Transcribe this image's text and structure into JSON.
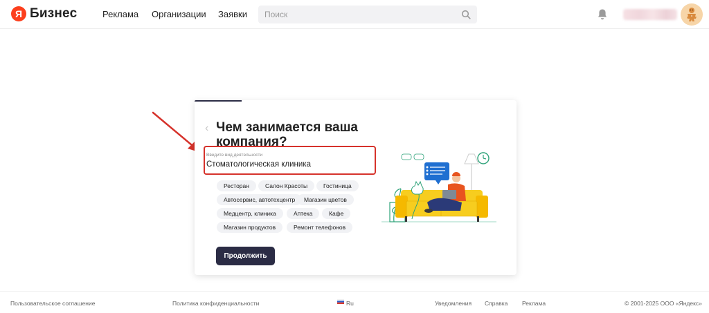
{
  "header": {
    "logo_letter": "Я",
    "logo_text": "Бизнес",
    "nav": [
      "Реклама",
      "Организации",
      "Заявки"
    ],
    "search_placeholder": "Поиск"
  },
  "card": {
    "back": "‹",
    "title": "Чем занимается ваша компания?",
    "field_label": "Введите вид деятельности",
    "field_value": "Стоматологическая клиника",
    "chips": [
      "Ресторан",
      "Салон Красоты",
      "Гостиница",
      "Автосервис, автотехцентр",
      "Магазин цветов",
      "Медцентр, клиника",
      "Аптека",
      "Кафе",
      "Магазин продуктов",
      "Ремонт телефонов"
    ],
    "continue_label": "Продолжить"
  },
  "footer": {
    "terms": "Пользовательское соглашение",
    "privacy": "Политика конфиденциальности",
    "lang": "Ru",
    "notifications": "Уведомления",
    "help": "Справка",
    "ads": "Реклама",
    "copyright": "© 2001-2025 ООО «Яндекс»"
  },
  "colors": {
    "accent_dark": "#2b2c45",
    "brand_red": "#fc3f1d",
    "annotation_red": "#d6322b"
  }
}
